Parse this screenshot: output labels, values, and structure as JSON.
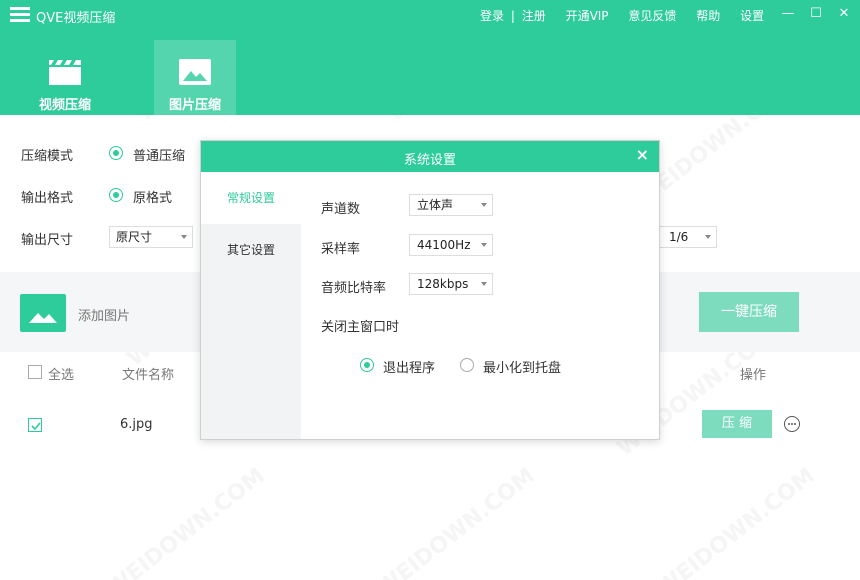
{
  "app": {
    "title": "QVE视频压缩"
  },
  "top_links": {
    "login": "登录",
    "separator": "|",
    "register": "注册",
    "vip": "开通VIP",
    "feedback": "意见反馈",
    "help": "帮助",
    "settings": "设置"
  },
  "window_controls": {
    "minimize": "—",
    "maximize": "☐",
    "close": "✕"
  },
  "tabs": [
    {
      "label": "视频压缩",
      "icon": "clapperboard-icon",
      "active": false
    },
    {
      "label": "图片压缩",
      "icon": "image-icon",
      "active": true
    }
  ],
  "form": {
    "mode_label": "压缩模式",
    "mode_option": "普通压缩",
    "format_label": "输出格式",
    "format_option": "原格式",
    "size_label": "输出尺寸",
    "size_value": "原尺寸",
    "ratio_value_partial": "1/6"
  },
  "toolbar": {
    "add_image_label": "添加图片",
    "compress_all_label": "一键压缩"
  },
  "table": {
    "select_all_label": "全选",
    "col_filename": "文件名称",
    "col_action": "操作",
    "rows": [
      {
        "checked": true,
        "filename": "6.jpg",
        "action_label": "压 缩"
      }
    ]
  },
  "dialog": {
    "title": "系统设置",
    "close_label": "×",
    "side_items": [
      {
        "label": "常规设置",
        "active": true
      },
      {
        "label": "其它设置",
        "active": false
      }
    ],
    "channels_label": "声道数",
    "channels_value": "立体声",
    "sample_rate_label": "采样率",
    "sample_rate_value": "44100Hz",
    "bitrate_label": "音频比特率",
    "bitrate_value": "128kbps",
    "close_window_label": "关闭主窗口时",
    "exit_option": "退出程序",
    "minimize_option": "最小化到托盘",
    "selected_close_option": "退出程序"
  },
  "watermark_text": "WEIDOWN.COM",
  "colors": {
    "accent": "#2ecb9b",
    "accent_light": "#7ddcbd",
    "tab_active": "#55d5ae"
  }
}
